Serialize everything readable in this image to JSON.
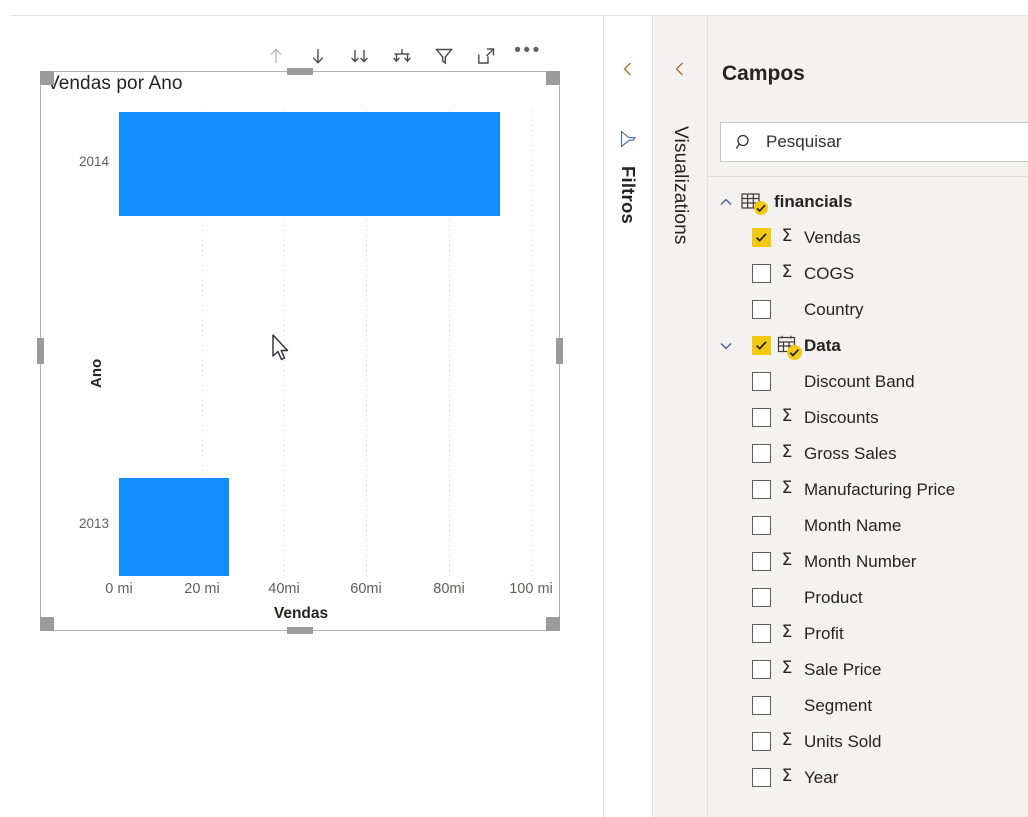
{
  "visual": {
    "title": "Vendas por Ano",
    "toolbar": [
      {
        "name": "drill-up-icon",
        "label": "Drill Up",
        "disabled": true
      },
      {
        "name": "drill-down-icon",
        "label": "Drill Down",
        "disabled": false
      },
      {
        "name": "expand-all-icon",
        "label": "Expand all down one level in the hierarchy",
        "disabled": false
      },
      {
        "name": "drill-next-level-icon",
        "label": "Go to the next level in the hierarchy",
        "disabled": false
      },
      {
        "name": "filter-icon",
        "label": "Filters",
        "disabled": false
      },
      {
        "name": "focus-mode-icon",
        "label": "Focus mode",
        "disabled": false
      },
      {
        "name": "more-options-icon",
        "label": "More options",
        "disabled": false
      }
    ]
  },
  "chart_data": {
    "type": "bar",
    "title": "Vendas por Ano",
    "orientation": "horizontal",
    "categories": [
      "2014",
      "2013"
    ],
    "values": [
      92,
      26.5
    ],
    "xlabel": "Vendas",
    "ylabel": "Ano",
    "xlim": [
      0,
      110
    ],
    "xticks": [
      0,
      20,
      40,
      60,
      80,
      100
    ],
    "xticklabels": [
      "0 mi",
      "20 mi",
      "40mi",
      "60mi",
      "80mi",
      "100 mi"
    ],
    "yticklabels": [
      "2014",
      "2013"
    ],
    "grid": "vertical-dotted",
    "legend": null,
    "series_color": "#118DFF"
  },
  "panes": {
    "filtros": {
      "label": "Filtros",
      "icon": "filter-icon",
      "collapse": "chevron-left-icon"
    },
    "visualizations": {
      "label": "Visualizations",
      "collapse": "chevron-left-icon"
    }
  },
  "fields": {
    "title": "Campos",
    "search_placeholder": "Pesquisar",
    "search_value": "",
    "items": [
      {
        "label": "financials",
        "type": "table-group",
        "expanded": true,
        "chevron": "chevron-up-icon",
        "checked": true,
        "indent": 0,
        "sigma": false,
        "icon": "table-icon"
      },
      {
        "label": "Vendas",
        "type": "field",
        "checked": true,
        "indent": 1,
        "sigma": true
      },
      {
        "label": "COGS",
        "type": "field",
        "checked": false,
        "indent": 1,
        "sigma": true
      },
      {
        "label": "Country",
        "type": "field",
        "checked": false,
        "indent": 1,
        "sigma": false
      },
      {
        "label": "Data",
        "type": "date-group",
        "expanded": true,
        "chevron": "chevron-down-icon",
        "checked": true,
        "indent": 0,
        "sigma": false,
        "icon": "calendar-icon"
      },
      {
        "label": "Discount Band",
        "type": "field",
        "checked": false,
        "indent": 1,
        "sigma": false
      },
      {
        "label": "Discounts",
        "type": "field",
        "checked": false,
        "indent": 1,
        "sigma": true
      },
      {
        "label": "Gross Sales",
        "type": "field",
        "checked": false,
        "indent": 1,
        "sigma": true
      },
      {
        "label": "Manufacturing Price",
        "type": "field",
        "checked": false,
        "indent": 1,
        "sigma": true
      },
      {
        "label": "Month Name",
        "type": "field",
        "checked": false,
        "indent": 1,
        "sigma": false
      },
      {
        "label": "Month Number",
        "type": "field",
        "checked": false,
        "indent": 1,
        "sigma": true
      },
      {
        "label": "Product",
        "type": "field",
        "checked": false,
        "indent": 1,
        "sigma": false
      },
      {
        "label": "Profit",
        "type": "field",
        "checked": false,
        "indent": 1,
        "sigma": true
      },
      {
        "label": "Sale Price",
        "type": "field",
        "checked": false,
        "indent": 1,
        "sigma": true
      },
      {
        "label": "Segment",
        "type": "field",
        "checked": false,
        "indent": 1,
        "sigma": false
      },
      {
        "label": "Units Sold",
        "type": "field",
        "checked": false,
        "indent": 1,
        "sigma": true
      },
      {
        "label": "Year",
        "type": "field",
        "checked": false,
        "indent": 1,
        "sigma": true
      }
    ]
  },
  "colors": {
    "series": "#118DFF",
    "accent_check": "#F2C811",
    "pane_bg": "#F3F2F1",
    "text": "#252423",
    "muted_text": "#605E5C"
  }
}
